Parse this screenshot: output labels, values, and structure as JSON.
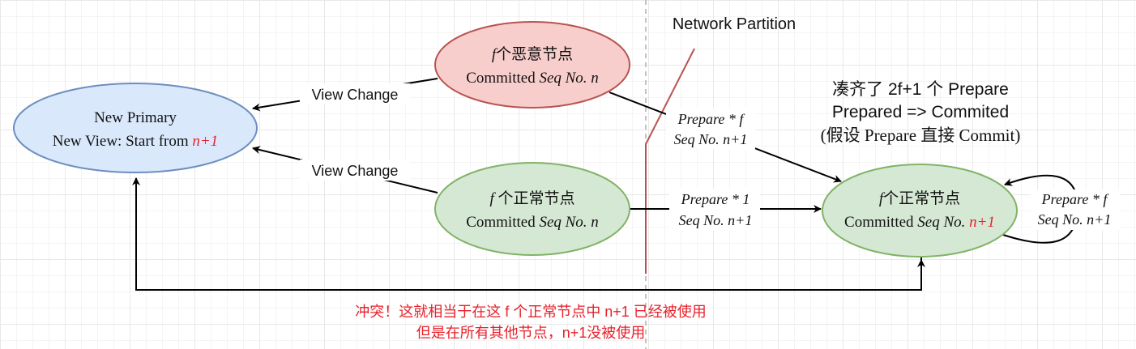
{
  "nodes": {
    "new_primary": {
      "line1": "New Primary",
      "line2_prefix": "New View: Start from ",
      "line2_value": "n+1",
      "fill": "#dae8fc",
      "stroke": "#6c8ebf"
    },
    "malicious": {
      "line1_var": "f",
      "line1_text": "个恶意节点",
      "line2_prefix": "Committed ",
      "line2_seq": "Seq No. n",
      "fill": "#f8cecc",
      "stroke": "#b85450"
    },
    "normal_left": {
      "line1_var": "f",
      "line1_text": " 个正常节点",
      "line2_prefix": "Committed ",
      "line2_seq": "Seq No. n",
      "fill": "#d5e8d4",
      "stroke": "#82b366"
    },
    "normal_right": {
      "line1_var": "f",
      "line1_text": "个正常节点",
      "line2_prefix": "Committed ",
      "line2_seq": "Seq No. ",
      "line2_value": "n+1",
      "fill": "#d5e8d4",
      "stroke": "#82b366"
    }
  },
  "edges": {
    "view_change_top": "View Change",
    "view_change_bottom": "View Change",
    "prepare_f_line1": "Prepare * f",
    "prepare_f_line2": "Seq No. n+1",
    "prepare_1_line1": "Prepare * 1",
    "prepare_1_line2": "Seq No. n+1",
    "self_loop_line1": "Prepare * f",
    "self_loop_line2": "Seq No. n+1"
  },
  "partition": {
    "label": "Network Partition",
    "line_color": "#b85450"
  },
  "annotation": {
    "line1": "凑齐了 2f+1 个 Prepare",
    "line2": "Prepared => Commited",
    "line3": "(假设 Prepare 直接 Commit)"
  },
  "conflict": {
    "line1": "冲突！这就相当于在这 f 个正常节点中 n+1 已经被使用",
    "line2": "但是在所有其他节点，n+1没被使用",
    "color": "#e8212b"
  }
}
